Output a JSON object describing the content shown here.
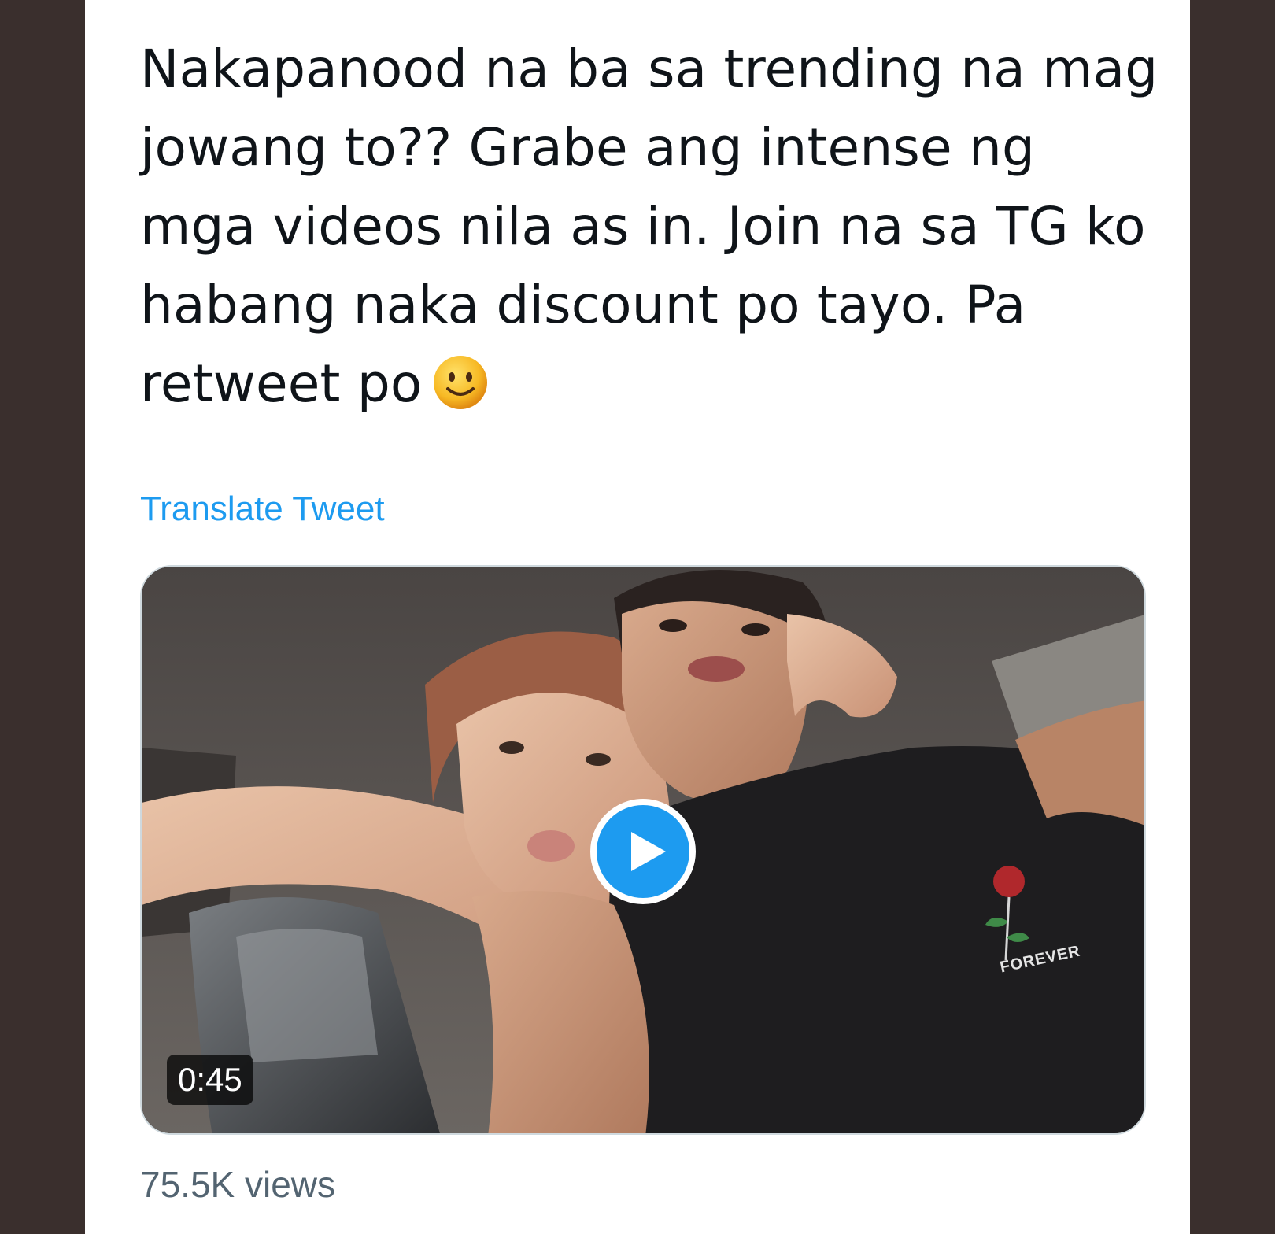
{
  "tweet": {
    "text": "Nakapanood na ba sa trending na mag jowang to?? Grabe ang intense ng mga videos nila as in. Join na sa TG ko habang naka discount po tayo. Pa retweet po",
    "emoji": "slightly-smiling-face",
    "translate_label": "Translate Tweet",
    "views_label": "75.5K views"
  },
  "media": {
    "duration": "0:45",
    "shirt_print": "FOREVER",
    "play_icon": "play-icon"
  },
  "colors": {
    "link": "#1d9bf0",
    "play_button": "#1d9bf0",
    "text": "#0f1419",
    "secondary_text": "#536471",
    "frame": "#3a2f2d"
  }
}
